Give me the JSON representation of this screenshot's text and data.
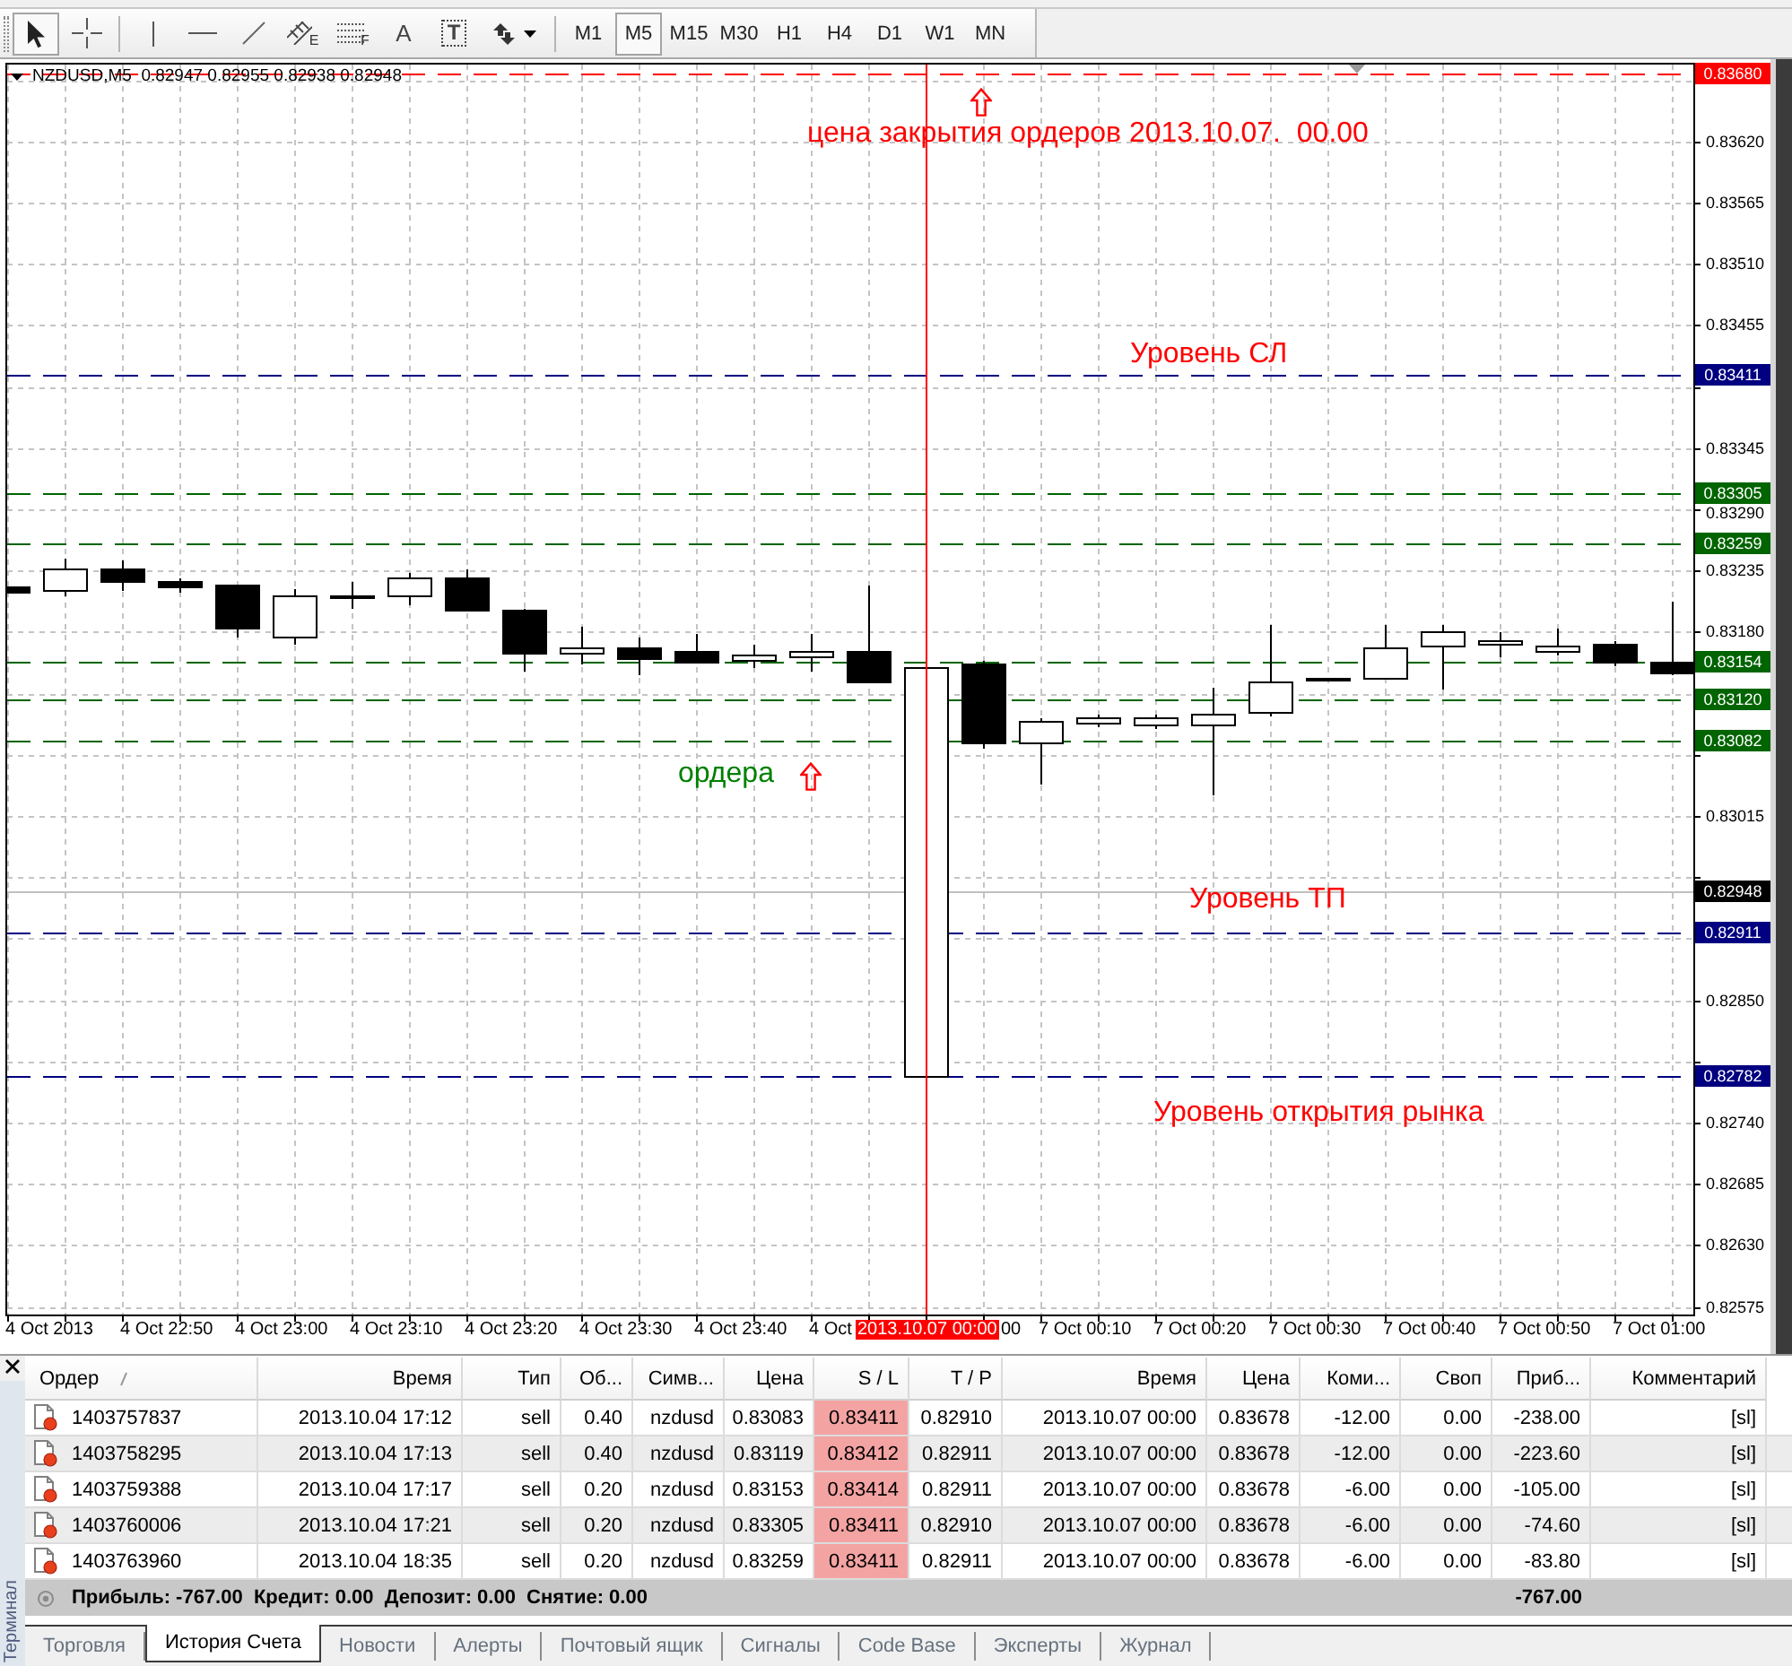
{
  "toolbar": {
    "cursor_tools": [
      {
        "kind": "pointer",
        "selected": true
      },
      {
        "kind": "crosshair",
        "selected": false
      }
    ],
    "object_tools": [
      {
        "kind": "vertical_line",
        "selected": false
      },
      {
        "kind": "horizontal_line",
        "selected": false
      },
      {
        "kind": "trendline",
        "selected": false
      },
      {
        "kind": "channel",
        "glyph": "E",
        "selected": false
      },
      {
        "kind": "fibonacci",
        "glyph": "F",
        "selected": false
      },
      {
        "kind": "text",
        "glyph": "A",
        "selected": false
      },
      {
        "kind": "label",
        "glyph": "T",
        "selected": false
      },
      {
        "kind": "arrows",
        "selected": false
      }
    ],
    "timeframes": [
      {
        "label": "M1",
        "selected": false
      },
      {
        "label": "M5",
        "selected": true
      },
      {
        "label": "M15",
        "selected": false
      },
      {
        "label": "M30",
        "selected": false
      },
      {
        "label": "H1",
        "selected": false
      },
      {
        "label": "H4",
        "selected": false
      },
      {
        "label": "D1",
        "selected": false
      },
      {
        "label": "W1",
        "selected": false
      },
      {
        "label": "MN",
        "selected": false
      }
    ]
  },
  "chart": {
    "header": "NZDUSD,M5  0.82947 0.82955 0.82938 0.82948",
    "price_axis": [
      "0.83620",
      "0.83565",
      "0.83510",
      "0.83455",
      "0.83345",
      "0.83290",
      "0.83235",
      "0.83180",
      "0.83015",
      "0.82850",
      "0.82740",
      "0.82685",
      "0.82630",
      "0.82575"
    ],
    "time_axis": [
      "4 Oct 2013",
      "4 Oct 22:50",
      "4 Oct 23:00",
      "4 Oct 23:10",
      "4 Oct 23:20",
      "4 Oct 23:30",
      "4 Oct 23:40",
      "4 Oct",
      "00",
      "7 Oct 00:10",
      "7 Oct 00:20",
      "7 Oct 00:30",
      "7 Oct 00:40",
      "7 Oct 00:50",
      "7 Oct 01:00"
    ],
    "level_lines": [
      {
        "kind": "dashed",
        "price": "0.83680",
        "color": "#ff0000"
      },
      {
        "kind": "dashed",
        "price": "0.83411",
        "color": "#000080"
      },
      {
        "kind": "dashed",
        "price": "0.83305",
        "color": "#006400"
      },
      {
        "kind": "dashed",
        "price": "0.83259",
        "color": "#006400"
      },
      {
        "kind": "dashed",
        "price": "0.83154",
        "color": "#006400"
      },
      {
        "kind": "dashed",
        "price": "0.83120",
        "color": "#006400"
      },
      {
        "kind": "dashed",
        "price": "0.83082",
        "color": "#006400"
      },
      {
        "kind": "solid",
        "price": "0.82948",
        "color": "#000000"
      },
      {
        "kind": "dashed",
        "price": "0.82911",
        "color": "#000080"
      },
      {
        "kind": "dashed",
        "price": "0.82782",
        "color": "#000080"
      }
    ],
    "vertical_line": {
      "label": "2013.10.07 00:00"
    },
    "annotations": [
      {
        "text": "цена закрытия ордеров 2013.10.07.  00.00",
        "color": "#ff0000"
      },
      {
        "text": "Уровень СЛ",
        "color": "#ff0000"
      },
      {
        "text": "ордера",
        "color": "#008000"
      },
      {
        "text": "Уровень ТП",
        "color": "#ff0000"
      },
      {
        "text": "Уровень открытия рынка",
        "color": "#ff0000"
      }
    ]
  },
  "terminal": {
    "title": "Терминал",
    "columns": [
      "Ордер",
      "Время",
      "Тип",
      "Об...",
      "Симв...",
      "Цена",
      "S / L",
      "T / P",
      "Время",
      "Цена",
      "Коми...",
      "Своп",
      "Приб...",
      "Комментарий"
    ],
    "rows": [
      {
        "cells": [
          "1403757837",
          "2013.10.04 17:12",
          "sell",
          "0.40",
          "nzdusd",
          "0.83083",
          "0.83411",
          "0.82910",
          "2013.10.07 00:00",
          "0.83678",
          "-12.00",
          "0.00",
          "-238.00",
          "[sl]"
        ],
        "sl_highlighted": true
      },
      {
        "cells": [
          "1403758295",
          "2013.10.04 17:13",
          "sell",
          "0.40",
          "nzdusd",
          "0.83119",
          "0.83412",
          "0.82911",
          "2013.10.07 00:00",
          "0.83678",
          "-12.00",
          "0.00",
          "-223.60",
          "[sl]"
        ],
        "sl_highlighted": true
      },
      {
        "cells": [
          "1403759388",
          "2013.10.04 17:17",
          "sell",
          "0.20",
          "nzdusd",
          "0.83153",
          "0.83414",
          "0.82911",
          "2013.10.07 00:00",
          "0.83678",
          "-6.00",
          "0.00",
          "-105.00",
          "[sl]"
        ],
        "sl_highlighted": true
      },
      {
        "cells": [
          "1403760006",
          "2013.10.04 17:21",
          "sell",
          "0.20",
          "nzdusd",
          "0.83305",
          "0.83411",
          "0.82910",
          "2013.10.07 00:00",
          "0.83678",
          "-6.00",
          "0.00",
          "-74.60",
          "[sl]"
        ],
        "sl_highlighted": true
      },
      {
        "cells": [
          "1403763960",
          "2013.10.04 18:35",
          "sell",
          "0.20",
          "nzdusd",
          "0.83259",
          "0.83411",
          "0.82911",
          "2013.10.07 00:00",
          "0.83678",
          "-6.00",
          "0.00",
          "-83.80",
          "[sl]"
        ],
        "sl_highlighted": true
      }
    ],
    "summary": {
      "text": "Прибыль: -767.00  Кредит: 0.00  Депозит: 0.00  Снятие: 0.00",
      "profit": "-767.00"
    },
    "tabs": [
      {
        "label": "Торговля",
        "selected": false
      },
      {
        "label": "История Счета",
        "selected": true
      },
      {
        "label": "Новости",
        "selected": false
      },
      {
        "label": "Алерты",
        "selected": false
      },
      {
        "label": "Почтовый ящик",
        "selected": false
      },
      {
        "label": "Сигналы",
        "selected": false
      },
      {
        "label": "Code Base",
        "selected": false
      },
      {
        "label": "Эксперты",
        "selected": false
      },
      {
        "label": "Журнал",
        "selected": false
      }
    ]
  }
}
